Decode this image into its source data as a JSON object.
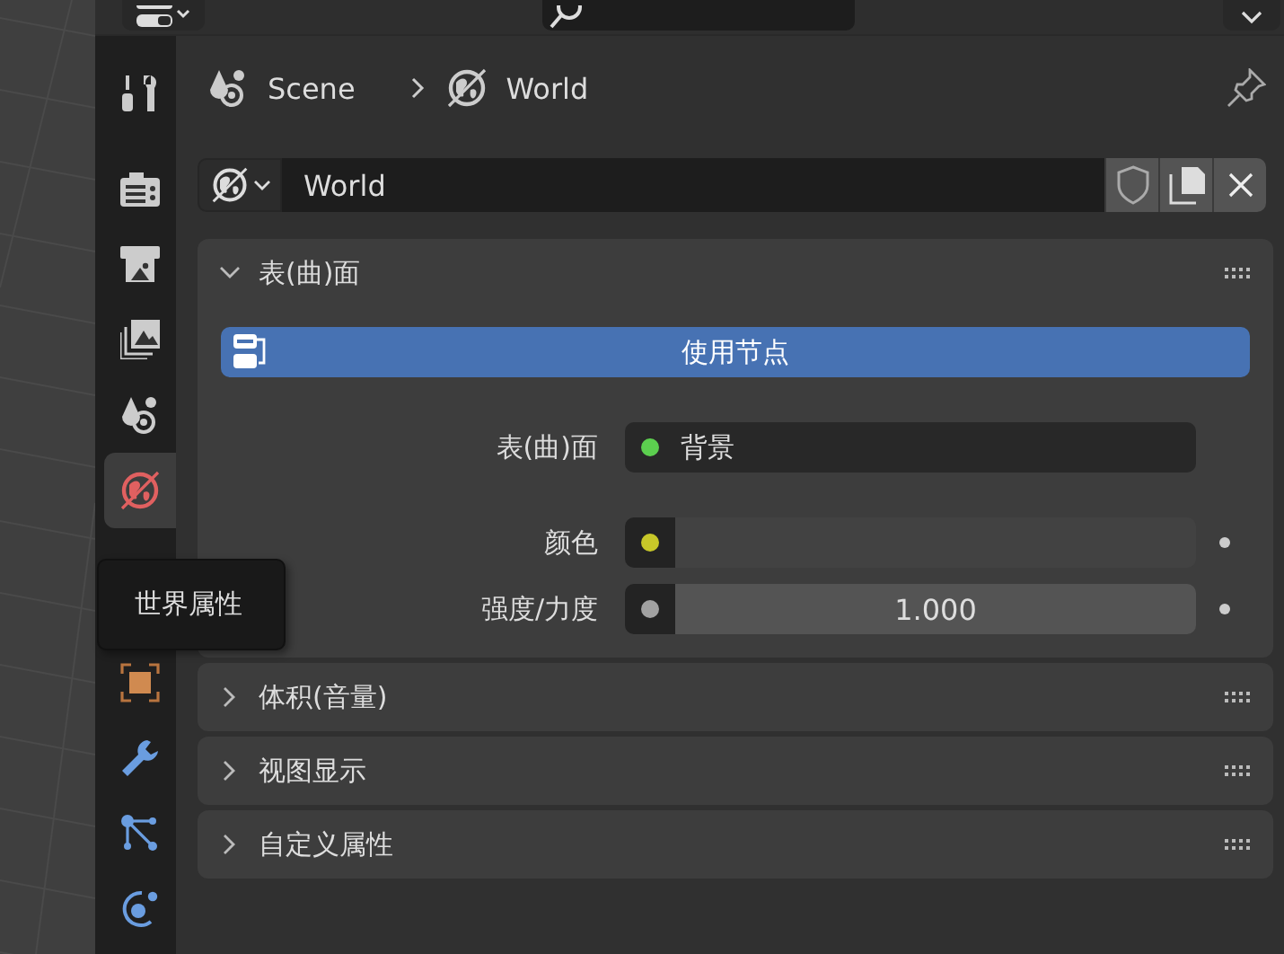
{
  "tabs": [
    {
      "kind": "tool",
      "selected": false
    },
    {
      "kind": "render",
      "selected": false
    },
    {
      "kind": "output",
      "selected": false
    },
    {
      "kind": "view_layer",
      "selected": false
    },
    {
      "kind": "scene",
      "selected": false
    },
    {
      "kind": "world",
      "selected": true
    },
    {
      "kind": "object",
      "selected": false
    },
    {
      "kind": "modifier",
      "selected": false
    },
    {
      "kind": "particles",
      "selected": false
    },
    {
      "kind": "physics",
      "selected": false
    }
  ],
  "tooltip": {
    "text": "世界属性"
  },
  "breadcrumb": [
    {
      "kind": "scene",
      "label": "Scene"
    },
    {
      "kind": "world",
      "label": "World"
    }
  ],
  "id_block": {
    "value": "World"
  },
  "panels": [
    {
      "title": "表(曲)面",
      "expanded": true,
      "button": "使用节点",
      "properties": [
        {
          "kind": "link",
          "label": "表(曲)面",
          "value": "背景",
          "color": "#5ccf4f"
        },
        {
          "kind": "color",
          "label": "颜色",
          "color": "#c7c729"
        },
        {
          "kind": "number",
          "label": "强度/力度",
          "value": "1.000",
          "color": "#a1a1a1"
        }
      ]
    },
    {
      "title": "体积(音量)",
      "expanded": false
    },
    {
      "title": "视图显示",
      "expanded": false
    },
    {
      "title": "自定义属性",
      "expanded": false
    }
  ]
}
